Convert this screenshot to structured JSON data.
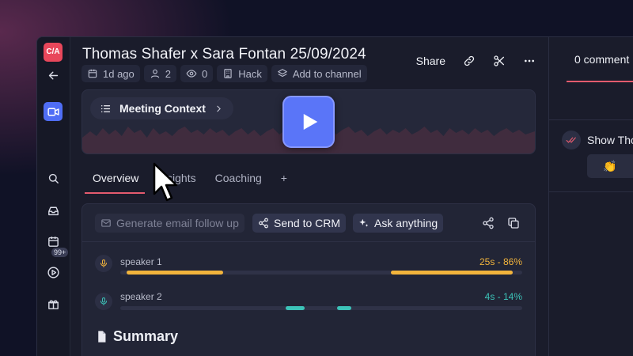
{
  "app": {
    "logo_text": "C/A"
  },
  "nav": {
    "badge": "99+"
  },
  "header": {
    "title": "Thomas Shafer x Sara Fontan 25/09/2024",
    "meta": {
      "time_ago": "1d ago",
      "participants": "2",
      "views": "0",
      "workspace": "Hack",
      "add_channel": "Add to channel"
    },
    "share_label": "Share"
  },
  "video": {
    "context_label": "Meeting Context"
  },
  "tabs": [
    "Overview",
    "Insights",
    "Coaching",
    "+"
  ],
  "toolbar": {
    "email_label": "Generate email follow up",
    "crm_label": "Send to CRM",
    "ask_label": "Ask anything"
  },
  "speakers": [
    {
      "name": "speaker 1",
      "stat": "25s - 86%",
      "color": "#f2b43c"
    },
    {
      "name": "speaker 2",
      "stat": "4s - 14%",
      "color": "#3cc3b8"
    }
  ],
  "summary": {
    "title": "Summary"
  },
  "comments": {
    "count_label": "0 comment",
    "show_label": "Show Tho",
    "emoji": "👏"
  },
  "colors": {
    "accent": "#5a75f8",
    "highlight": "#e45b6e"
  }
}
